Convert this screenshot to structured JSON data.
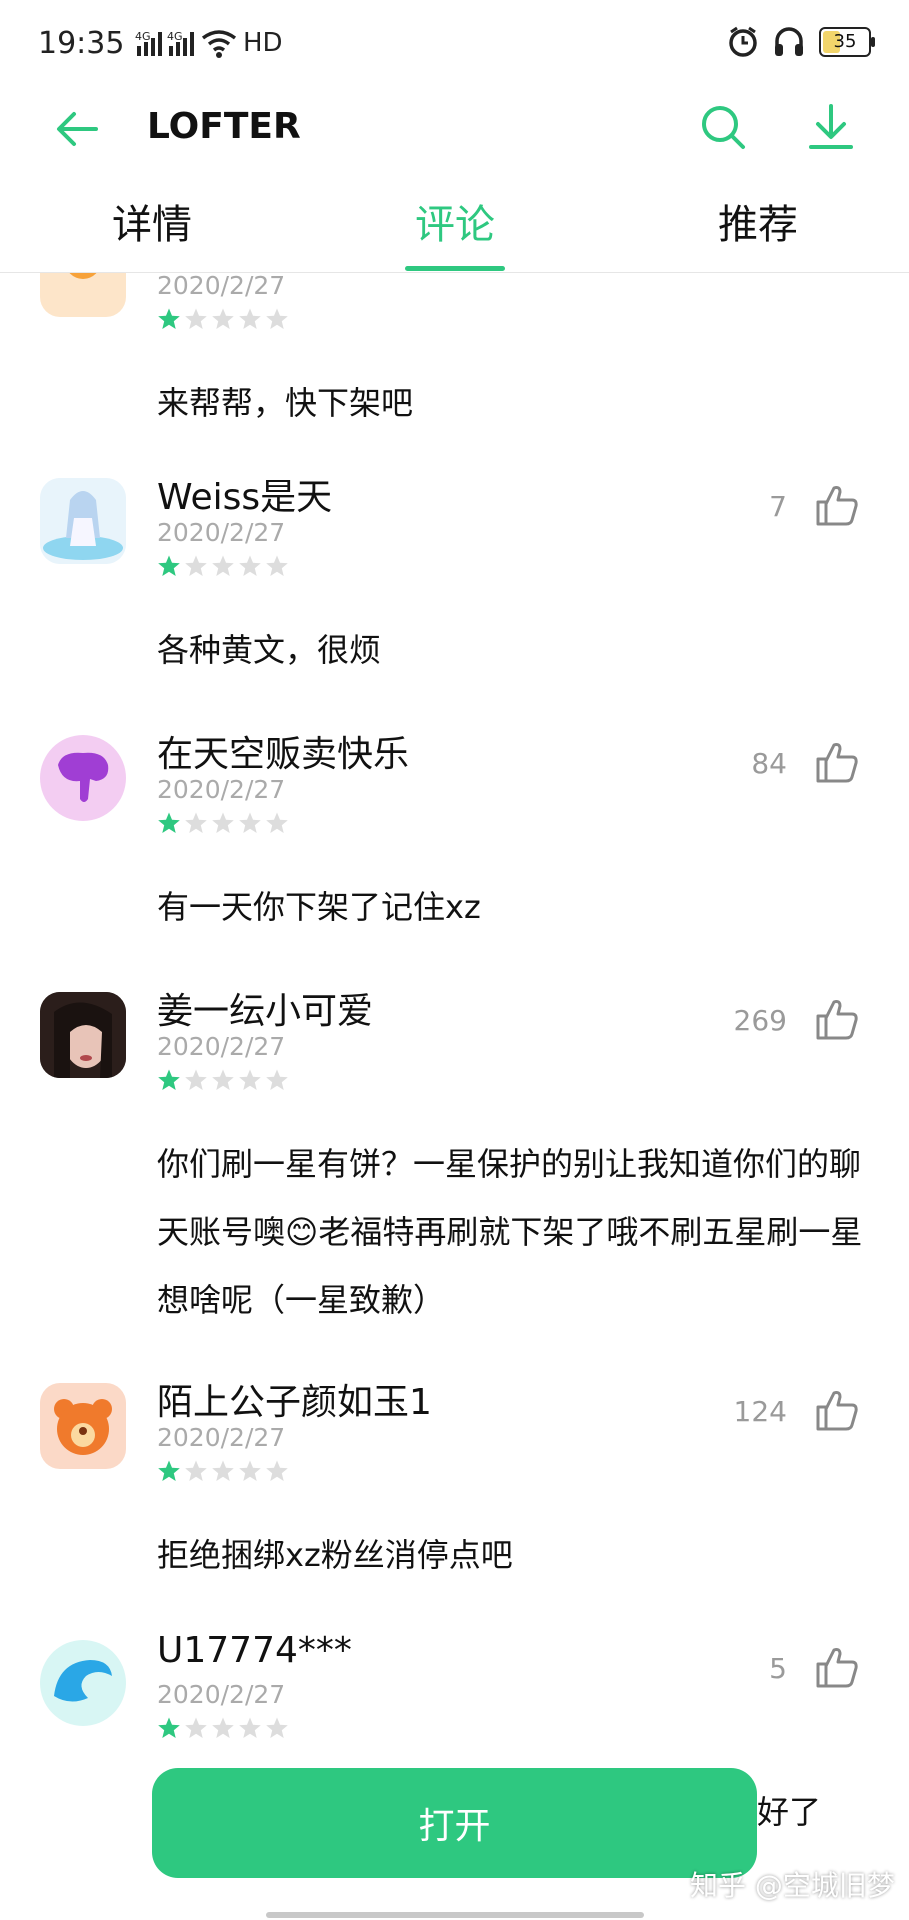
{
  "status": {
    "time": "19:35",
    "network": "4G 4G",
    "hd": "HD",
    "battery": "35",
    "battery_fraction": 0.35
  },
  "appbar": {
    "title": "LOFTER"
  },
  "tabs": [
    {
      "label": "详情",
      "active": false
    },
    {
      "label": "评论",
      "active": true
    },
    {
      "label": "推荐",
      "active": false
    }
  ],
  "comments": [
    {
      "name": "",
      "date": "2020/2/27",
      "rating": 1,
      "likes": "",
      "text": "来帮帮，快下架吧",
      "avatar_color": "#f7a23a"
    },
    {
      "name": "Weiss是天",
      "date": "2020/2/27",
      "rating": 1,
      "likes": "7",
      "text": "各种黄文，很烦",
      "avatar_color": "#bfe4f5"
    },
    {
      "name": "在天空贩卖快乐",
      "date": "2020/2/27",
      "rating": 1,
      "likes": "84",
      "text": "有一天你下架了记住xz",
      "avatar_color": "#f3cdf2"
    },
    {
      "name": "姜一纭小可爱",
      "date": "2020/2/27",
      "rating": 1,
      "likes": "269",
      "text": "你们刷一星有饼？一星保护的别让我知道你们的聊天账号噢😊老福特再刷就下架了哦不刷五星刷一星想啥呢（一星致歉）",
      "avatar_color": "#3a2a26"
    },
    {
      "name": "陌上公子颜如玉1",
      "date": "2020/2/27",
      "rating": 1,
      "likes": "124",
      "text": "拒绝捆绑xz粉丝消停点吧",
      "avatar_color": "#fbd9c7"
    },
    {
      "name": "U17774***",
      "date": "2020/2/27",
      "rating": 1,
      "likes": "5",
      "text": "好了",
      "avatar_color": "#c8f2f0"
    }
  ],
  "open_button": "打开",
  "watermark": "知乎 @空城旧梦",
  "colors": {
    "accent": "#2ec880",
    "star_empty": "#dddddd"
  }
}
